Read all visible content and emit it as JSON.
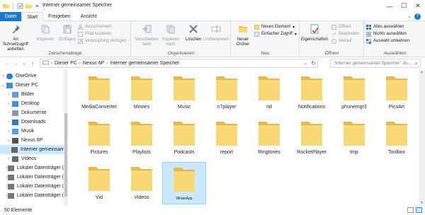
{
  "window": {
    "title": "Interner gemeinsamer Speicher",
    "controls": [
      "—",
      "☐",
      "✕"
    ]
  },
  "ribbon_tabs": {
    "file": "Datei",
    "start": "Start",
    "share": "Freigeben",
    "view": "Ansicht"
  },
  "ribbon": {
    "clipboard": {
      "label": "Zwischenablage",
      "pin": "An Schnellzugriff anheften",
      "copy": "Kopieren",
      "paste": "Einfügen",
      "cut": "Ausschneiden",
      "copy_path": "Pfad kopieren",
      "paste_shortcut": "Verknüpfung einfügen"
    },
    "organize": {
      "label": "Organisieren",
      "move_to": "Verschieben nach",
      "copy_to": "Kopieren nach",
      "delete": "Löschen",
      "rename": "Umbenennen"
    },
    "new": {
      "label": "Neu",
      "new_folder": "Neuer Ordner",
      "new_item": "Neues Element",
      "easy_access": "Einfacher Zugriff"
    },
    "open": {
      "label": "Öffnen",
      "properties": "Eigenschaften",
      "open": "Öffnen",
      "edit": "Bearbeiten",
      "history": "Verlauf"
    },
    "select": {
      "label": "Auswählen",
      "select_all": "Alles auswählen",
      "select_none": "Nichts auswählen",
      "invert": "Auswahl umkehren"
    }
  },
  "address": {
    "crumbs": [
      "Dieser PC",
      "Nexus 6P",
      "Interner gemeinsamer Speicher"
    ],
    "search_placeholder": "\"Interner gemeinsamer Speicher\" du..."
  },
  "sidebar": {
    "items": [
      {
        "label": "OneDrive",
        "icon": "cloud-icon"
      },
      {
        "label": "Dieser PC",
        "icon": "computer-icon"
      },
      {
        "label": "Bilder",
        "icon": "pictures-icon"
      },
      {
        "label": "Desktop",
        "icon": "desktop-icon"
      },
      {
        "label": "Dokumente",
        "icon": "documents-icon"
      },
      {
        "label": "Downloads",
        "icon": "downloads-icon"
      },
      {
        "label": "Musik",
        "icon": "music-icon"
      },
      {
        "label": "Nexus 6P",
        "icon": "phone-icon"
      },
      {
        "label": "Interner gemeinsamer Speicher",
        "icon": "storage-icon"
      },
      {
        "label": "Videos",
        "icon": "videos-icon"
      },
      {
        "label": "Lokaler Datenträger (",
        "icon": "drive-icon"
      },
      {
        "label": "Lokaler Datenträger (",
        "icon": "drive-icon"
      },
      {
        "label": "Lokaler Datenträger (",
        "icon": "drive-icon"
      },
      {
        "label": "Lokaler Datenträger (",
        "icon": "drive-icon"
      }
    ]
  },
  "folders": [
    "MediaConverter",
    "Movies",
    "Music",
    "n7player",
    "nd",
    "Notifications",
    "phonemgr3",
    "PicsArt",
    "Pictures",
    "Playlists",
    "Podcasts",
    "report",
    "Ringtones",
    "RocketPlayer",
    "tmp",
    "Toolbox",
    "Vid",
    "Videos",
    "WhatsApp"
  ],
  "selected_folder": "WhatsApp",
  "status": {
    "count": "50 Elemente"
  },
  "colors": {
    "accent": "#1979ca",
    "selection": "#cce8ff",
    "folder": "#f8d775",
    "folder_back": "#e8b84a"
  }
}
